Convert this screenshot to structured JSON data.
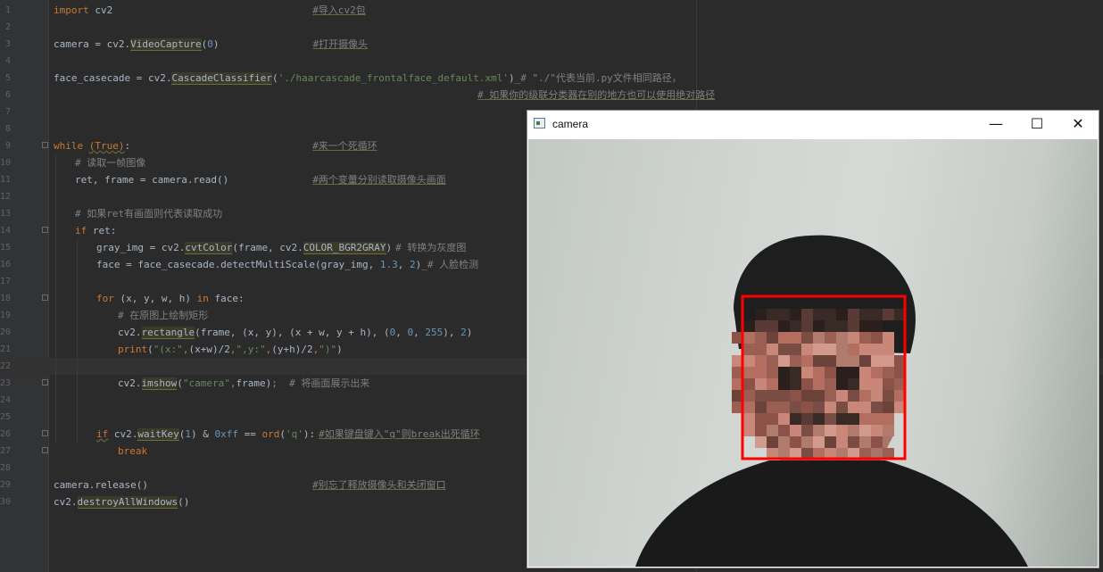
{
  "editor": {
    "lines": [
      {
        "n": "1",
        "segs": [
          {
            "c": "kw",
            "t": "import"
          },
          {
            "c": "tx",
            "t": " cv2"
          },
          {
            "c": "pad",
            "to": 290
          },
          {
            "c": "cm-u",
            "t": "#导入cv2包"
          }
        ]
      },
      {
        "n": "2",
        "segs": []
      },
      {
        "n": "3",
        "segs": [
          {
            "c": "tx",
            "t": "camera = cv2."
          },
          {
            "c": "fn",
            "t": "VideoCapture"
          },
          {
            "c": "tx",
            "t": "("
          },
          {
            "c": "nu",
            "t": "0"
          },
          {
            "c": "tx",
            "t": ")"
          },
          {
            "c": "pad",
            "to": 290
          },
          {
            "c": "cm-u",
            "t": "#打开摄像头"
          }
        ]
      },
      {
        "n": "4",
        "segs": []
      },
      {
        "n": "5",
        "segs": [
          {
            "c": "tx",
            "t": "face_casecade = cv2."
          },
          {
            "c": "fn",
            "t": "CascadeClassifier"
          },
          {
            "c": "tx",
            "t": "("
          },
          {
            "c": "st",
            "t": "'./haarcascade_frontalface_default.xml'"
          },
          {
            "c": "tx",
            "t": ")"
          },
          {
            "c": "kw",
            "t": "_"
          },
          {
            "c": "cm",
            "t": "# \"./\"代表当前.py文件相同路径，"
          }
        ]
      },
      {
        "n": "6",
        "segs": [
          {
            "c": "pad",
            "to": 475
          },
          {
            "c": "cm-u",
            "t": "# 如果你的级联分类器在别的地方也可以使用绝对路径"
          }
        ]
      },
      {
        "n": "7",
        "segs": []
      },
      {
        "n": "8",
        "segs": []
      },
      {
        "n": "9",
        "fold": true,
        "segs": [
          {
            "c": "kw",
            "t": "while"
          },
          {
            "c": "tx",
            "t": " "
          },
          {
            "c": "kw wave",
            "t": "(True)"
          },
          {
            "c": "tx",
            "t": ":"
          },
          {
            "c": "pad",
            "to": 290
          },
          {
            "c": "cm-u",
            "t": "#来一个死循环"
          }
        ]
      },
      {
        "n": "10",
        "segs": [
          {
            "c": "indent",
            "to": 24
          },
          {
            "c": "cm",
            "t": "# 读取一帧图像"
          }
        ]
      },
      {
        "n": "11",
        "segs": [
          {
            "c": "indent",
            "to": 24
          },
          {
            "c": "tx",
            "t": "ret, frame = camera.read()"
          },
          {
            "c": "pad",
            "to": 290
          },
          {
            "c": "cm-u",
            "t": "#两个变量分别读取摄像头画面"
          }
        ]
      },
      {
        "n": "12",
        "segs": []
      },
      {
        "n": "13",
        "segs": [
          {
            "c": "indent",
            "to": 24
          },
          {
            "c": "cm",
            "t": "# 如果ret有画面则代表读取成功"
          }
        ]
      },
      {
        "n": "14",
        "fold": true,
        "segs": [
          {
            "c": "indent",
            "to": 24
          },
          {
            "c": "kw",
            "t": "if"
          },
          {
            "c": "tx",
            "t": " ret:"
          }
        ]
      },
      {
        "n": "15",
        "segs": [
          {
            "c": "indent",
            "to": 48
          },
          {
            "c": "tx",
            "t": "gray_img = cv2."
          },
          {
            "c": "fn",
            "t": "cvtColor"
          },
          {
            "c": "tx",
            "t": "(frame, cv2."
          },
          {
            "c": "fn",
            "t": "COLOR_BGR2GRAY"
          },
          {
            "c": "tx",
            "t": ")"
          },
          {
            "c": "pad",
            "to": 370
          },
          {
            "c": "cm",
            "t": "# 转换为灰度图"
          }
        ]
      },
      {
        "n": "16",
        "segs": [
          {
            "c": "indent",
            "to": 48
          },
          {
            "c": "tx",
            "t": "face = face_casecade.detectMultiScale(gray_img, "
          },
          {
            "c": "nu",
            "t": "1.3"
          },
          {
            "c": "tx",
            "t": ", "
          },
          {
            "c": "nu",
            "t": "2"
          },
          {
            "c": "tx",
            "t": ")"
          },
          {
            "c": "kw",
            "t": "_"
          },
          {
            "c": "cm",
            "t": "# 人脸检测"
          }
        ]
      },
      {
        "n": "17",
        "segs": []
      },
      {
        "n": "18",
        "fold": true,
        "segs": [
          {
            "c": "indent",
            "to": 48
          },
          {
            "c": "kw",
            "t": "for"
          },
          {
            "c": "tx",
            "t": " (x, y, w, h) "
          },
          {
            "c": "kw",
            "t": "in"
          },
          {
            "c": "tx",
            "t": " face:"
          }
        ]
      },
      {
        "n": "19",
        "segs": [
          {
            "c": "indent",
            "to": 72
          },
          {
            "c": "cm",
            "t": "# 在原图上绘制矩形"
          }
        ]
      },
      {
        "n": "20",
        "segs": [
          {
            "c": "indent",
            "to": 72
          },
          {
            "c": "tx",
            "t": "cv2."
          },
          {
            "c": "fn",
            "t": "rectangle"
          },
          {
            "c": "tx",
            "t": "(frame, (x, y), (x + w, y + h), ("
          },
          {
            "c": "nu",
            "t": "0"
          },
          {
            "c": "tx",
            "t": ", "
          },
          {
            "c": "nu",
            "t": "0"
          },
          {
            "c": "tx",
            "t": ", "
          },
          {
            "c": "nu",
            "t": "255"
          },
          {
            "c": "tx",
            "t": "), "
          },
          {
            "c": "nu",
            "t": "2"
          },
          {
            "c": "tx",
            "t": ")"
          }
        ]
      },
      {
        "n": "21",
        "segs": [
          {
            "c": "indent",
            "to": 72
          },
          {
            "c": "kw",
            "t": "print"
          },
          {
            "c": "tx",
            "t": "("
          },
          {
            "c": "st",
            "t": "\"(x:\""
          },
          {
            "c": "kw",
            "t": ","
          },
          {
            "c": "tx",
            "t": "(x+w)/2"
          },
          {
            "c": "kw",
            "t": ","
          },
          {
            "c": "st",
            "t": "\",y:\""
          },
          {
            "c": "kw",
            "t": ","
          },
          {
            "c": "tx",
            "t": "(y+h)/2"
          },
          {
            "c": "kw",
            "t": ","
          },
          {
            "c": "st",
            "t": "\")\""
          },
          {
            "c": "tx",
            "t": ")"
          }
        ]
      },
      {
        "n": "22",
        "current": true,
        "segs": []
      },
      {
        "n": "23",
        "fold": true,
        "segs": [
          {
            "c": "indent",
            "to": 72
          },
          {
            "c": "tx",
            "t": "cv2."
          },
          {
            "c": "fn",
            "t": "imshow"
          },
          {
            "c": "tx",
            "t": "("
          },
          {
            "c": "st",
            "t": "\"camera\""
          },
          {
            "c": "kw",
            "t": ","
          },
          {
            "c": "tx",
            "t": "frame)"
          },
          {
            "c": "kw",
            "t": ";"
          },
          {
            "c": "tx",
            "t": "  "
          },
          {
            "c": "cm",
            "t": "# 将画面展示出来"
          }
        ]
      },
      {
        "n": "24",
        "segs": []
      },
      {
        "n": "25",
        "segs": []
      },
      {
        "n": "26",
        "fold": true,
        "segs": [
          {
            "c": "indent",
            "to": 48
          },
          {
            "c": "kw wave",
            "t": "if"
          },
          {
            "c": "tx",
            "t": " cv2."
          },
          {
            "c": "fn",
            "t": "waitKey"
          },
          {
            "c": "tx",
            "t": "("
          },
          {
            "c": "nu",
            "t": "1"
          },
          {
            "c": "tx",
            "t": ") & "
          },
          {
            "c": "nu",
            "t": "0xff"
          },
          {
            "c": "tx",
            "t": " == "
          },
          {
            "c": "kw",
            "t": "ord"
          },
          {
            "c": "tx",
            "t": "("
          },
          {
            "c": "st",
            "t": "'q'"
          },
          {
            "c": "tx",
            "t": "):"
          },
          {
            "c": "pad",
            "to": 290
          },
          {
            "c": "cm-u",
            "t": "#如果键盘键入\"q\"则break出死循环"
          }
        ]
      },
      {
        "n": "27",
        "fold": true,
        "segs": [
          {
            "c": "indent",
            "to": 72
          },
          {
            "c": "kw",
            "t": "break"
          }
        ]
      },
      {
        "n": "28",
        "segs": []
      },
      {
        "n": "29",
        "segs": [
          {
            "c": "tx",
            "t": "camera.release()"
          },
          {
            "c": "pad",
            "to": 290
          },
          {
            "c": "cm-u",
            "t": "#别忘了释放摄像头和关闭窗口"
          }
        ]
      },
      {
        "n": "30",
        "segs": [
          {
            "c": "tx",
            "t": "cv2."
          },
          {
            "c": "fn",
            "t": "destroyAllWindows"
          },
          {
            "c": "tx",
            "t": "()"
          }
        ]
      }
    ]
  },
  "camera_window": {
    "title": "camera",
    "minimize_glyph": "—",
    "maximize_glyph": "☐",
    "close_glyph": "✕",
    "detection_color": "#ff0000"
  }
}
